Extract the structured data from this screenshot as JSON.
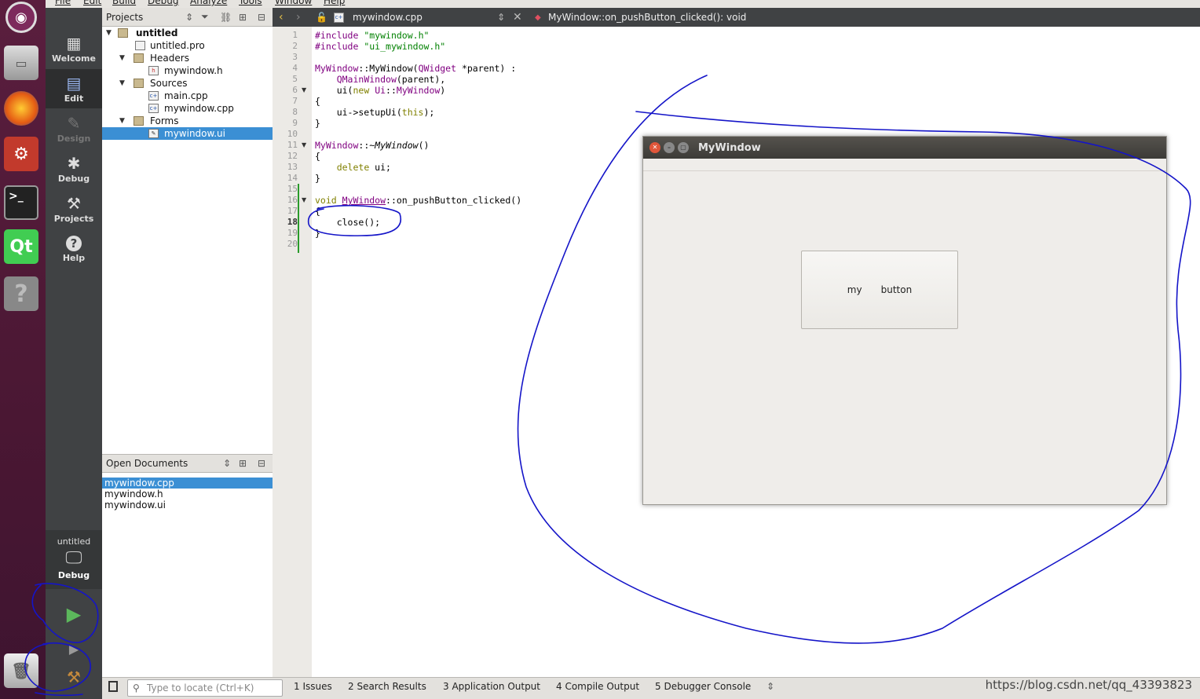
{
  "menubar": [
    "File",
    "Edit",
    "Build",
    "Debug",
    "Analyze",
    "Tools",
    "Window",
    "Help"
  ],
  "modes": [
    {
      "label": "Welcome",
      "icon": "grid-icon",
      "glyph": "▦"
    },
    {
      "label": "Edit",
      "icon": "edit-icon",
      "glyph": "▤"
    },
    {
      "label": "Design",
      "icon": "pencil-icon",
      "glyph": "✎"
    },
    {
      "label": "Debug",
      "icon": "bug-icon",
      "glyph": "✱"
    },
    {
      "label": "Projects",
      "icon": "wrench-icon",
      "glyph": "⚒"
    },
    {
      "label": "Help",
      "icon": "help-icon",
      "glyph": "?"
    }
  ],
  "kit": {
    "project": "untitled",
    "build": "Debug"
  },
  "projects_pane": {
    "title": "Projects",
    "tree": [
      {
        "label": "untitled",
        "icon": "project-icon"
      },
      {
        "label": "untitled.pro",
        "icon": "pro-file-icon"
      },
      {
        "label": "Headers",
        "icon": "folder-icon"
      },
      {
        "label": "mywindow.h",
        "icon": "header-file-icon"
      },
      {
        "label": "Sources",
        "icon": "folder-icon"
      },
      {
        "label": "main.cpp",
        "icon": "cpp-file-icon"
      },
      {
        "label": "mywindow.cpp",
        "icon": "cpp-file-icon"
      },
      {
        "label": "Forms",
        "icon": "folder-icon"
      },
      {
        "label": "mywindow.ui",
        "icon": "ui-file-icon"
      }
    ]
  },
  "open_documents": {
    "title": "Open Documents",
    "items": [
      "mywindow.cpp",
      "mywindow.h",
      "mywindow.ui"
    ]
  },
  "editor": {
    "file": "mywindow.cpp",
    "function": "MyWindow::on_pushButton_clicked(): void",
    "line_numbers": [
      "1",
      "2",
      "3",
      "4",
      "5",
      "6",
      "7",
      "8",
      "9",
      "10",
      "11",
      "12",
      "13",
      "14",
      "15",
      "16",
      "17",
      "18",
      "19",
      "20"
    ]
  },
  "app_window": {
    "title": "MyWindow",
    "button_text_1": "my",
    "button_text_2": "button"
  },
  "statusbar": {
    "locate_placeholder": "Type to locate (Ctrl+K)",
    "tabs": [
      "1  Issues",
      "2  Search Results",
      "3  Application Output",
      "4  Compile Output",
      "5  Debugger Console"
    ],
    "watermark": "https://blog.csdn.net/qq_43393823"
  },
  "colors": {
    "selection": "#3b8fd4",
    "annotation": "#1414c8",
    "launcher": "#4a1733"
  }
}
